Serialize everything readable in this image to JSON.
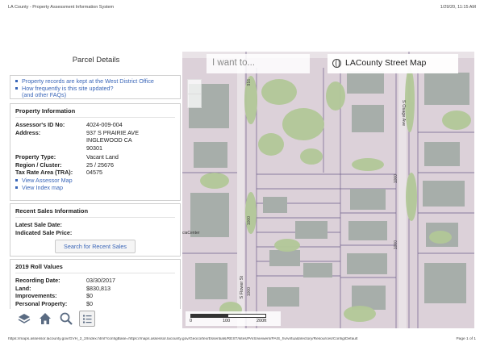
{
  "print_header": {
    "left": "LA County - Property Assessment Information System",
    "right": "1/29/20, 11:15 AM"
  },
  "print_footer": {
    "url": "https://maps.assessor.lacounty.gov/GVH_2_2/Index.html?configBase=https://maps.assessor.lacounty.gov/Geocortex/Essentials/REST/sites/PAIS/viewers/PAIS_hv/virtualdirectory/Resources/Config/Default",
    "page": "Page 1 of 1"
  },
  "panel": {
    "title": "Parcel Details",
    "faq": {
      "item1": "Property records are kept at the West District Office",
      "item2": "How frequently is this site updated?",
      "item2_sub": "(and other FAQs)"
    },
    "property_info": {
      "title": "Property Information",
      "ain_label": "Assessor's ID No:",
      "ain_value": "4024-009-004",
      "address_label": "Address:",
      "address_line1": "937 S PRAIRIE AVE",
      "address_line2": "INGLEWOOD CA",
      "address_line3": "90301",
      "type_label": "Property Type:",
      "type_value": "Vacant Land",
      "region_label": "Region / Cluster:",
      "region_value": "25 / 25676",
      "tra_label": "Tax Rate Area (TRA):",
      "tra_value": "04575",
      "link_assessor": "View Assessor Map",
      "link_index": "View Index map"
    },
    "sales": {
      "title": "Recent Sales Information",
      "latest_label": "Latest Sale Date:",
      "price_label": "Indicated Sale Price:",
      "search_button": "Search for Recent Sales"
    },
    "roll": {
      "title": "2019 Roll Values",
      "recording_label": "Recording Date:",
      "recording_value": "03/30/2017",
      "land_label": "Land:",
      "land_value": "$830,813",
      "impr_label": "Improvements:",
      "impr_value": "$0",
      "personal_label": "Personal Property:",
      "personal_value": "$0"
    }
  },
  "toolbar": {
    "icons": [
      "layers-icon",
      "home-icon",
      "search-icon",
      "list-icon"
    ]
  },
  "map": {
    "i_want_to": "I want to...",
    "basemap_label": "LACounty Street Map",
    "streets": {
      "flower": "S Flower St",
      "osage": "S Osage Ave"
    },
    "house_numbers": [
      "916",
      "1000",
      "1000",
      "1000",
      "1000"
    ],
    "scale": {
      "zero": "0",
      "mid": "100",
      "end": "200ft"
    },
    "attribution": "ciaCenter"
  },
  "colors": {
    "link": "#3a66b8",
    "map_pink": "#ddd0d8",
    "map_green": "#b4c99a",
    "building": "#a5aca8"
  }
}
